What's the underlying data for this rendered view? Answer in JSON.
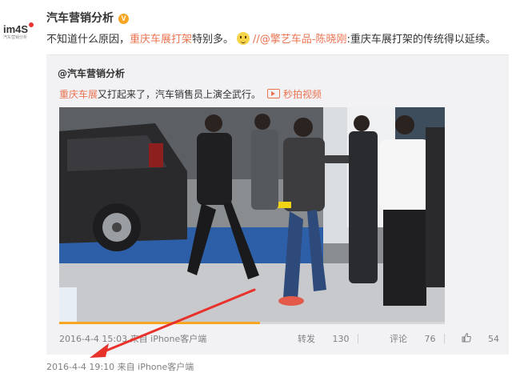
{
  "avatar": {
    "logo_text": "im4S",
    "sub_text": "汽车营销分析"
  },
  "post": {
    "author": "汽车营销分析",
    "verified_badge": "V",
    "text_part1": "不知道什么原因，",
    "link_text": "重庆车展打架",
    "text_part2": "特别多。",
    "mention_text": "//@擎艺车品-陈晓刚",
    "text_part3": ":重庆车展打架的传统得以延续。",
    "emoji_name": "face-emoji"
  },
  "repost": {
    "author": "@汽车营销分析",
    "link_text": "重庆车展",
    "text": "又打起来了，汽车销售员上演全武行。",
    "video_label": "秒拍视频",
    "progress_fraction": 0.52,
    "timestamp": "2016-4-4 15:03",
    "source": "来自 iPhone客户端",
    "repost_label": "转发",
    "repost_count": "130",
    "comment_label": "评论",
    "comment_count": "76",
    "like_count": "54"
  },
  "footer": {
    "timestamp": "2016-4-4 19:10",
    "source": "来自 iPhone客户端"
  },
  "colors": {
    "link": "#eb7350",
    "arrow": "#e8312a",
    "badge": "#f6a623"
  }
}
